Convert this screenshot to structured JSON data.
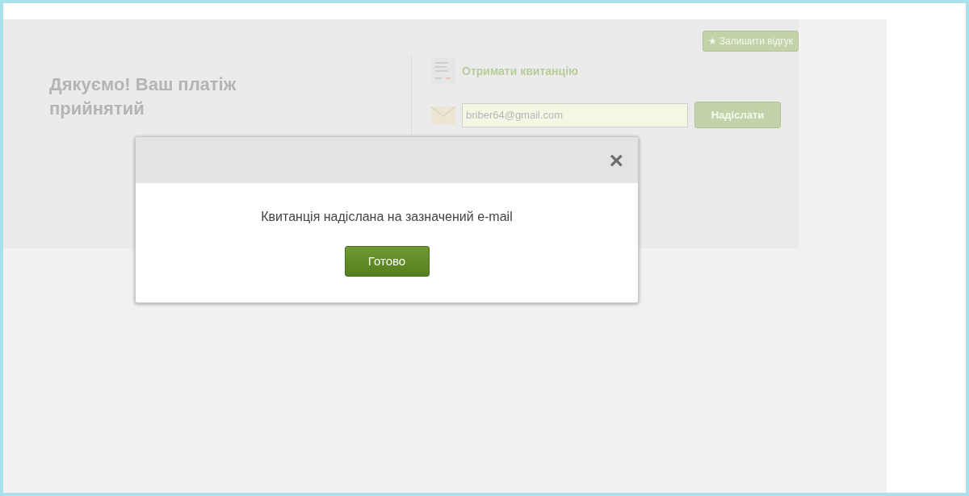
{
  "page": {
    "feedback_button": {
      "icon": "★",
      "label": "Залишити відгук"
    },
    "heading": "Дякуємо! Ваш платіж прийнятий",
    "receipt": {
      "title": "Отримати квитанцію",
      "email_value": "briber64@gmail.com",
      "send_button": "Надіслати"
    }
  },
  "modal": {
    "close": "×",
    "message": "Квитанція надіслана на зазначений e-mail",
    "button": "Готово"
  }
}
